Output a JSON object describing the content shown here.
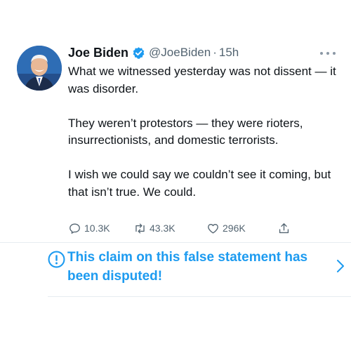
{
  "tweet": {
    "author_name": "Joe Biden",
    "handle": "@JoeBiden",
    "separator": "·",
    "time": "15h",
    "verified_icon": "verified-badge-icon",
    "paragraphs": [
      "What we witnessed yesterday was not dissent — it was disorder.",
      "They weren’t protestors — they were rioters, insurrectionists, and domestic terrorists.",
      "I wish we could say we couldn’t see it coming, but that isn’t true. We could."
    ],
    "actions": {
      "replies": "10.3K",
      "retweets": "43.3K",
      "likes": "296K"
    }
  },
  "notice": {
    "text": "This claim on this false statement has been disputed!",
    "icon": "info-icon"
  },
  "colors": {
    "accent": "#1d9bf0",
    "text": "#0f1419",
    "secondary": "#536471"
  }
}
